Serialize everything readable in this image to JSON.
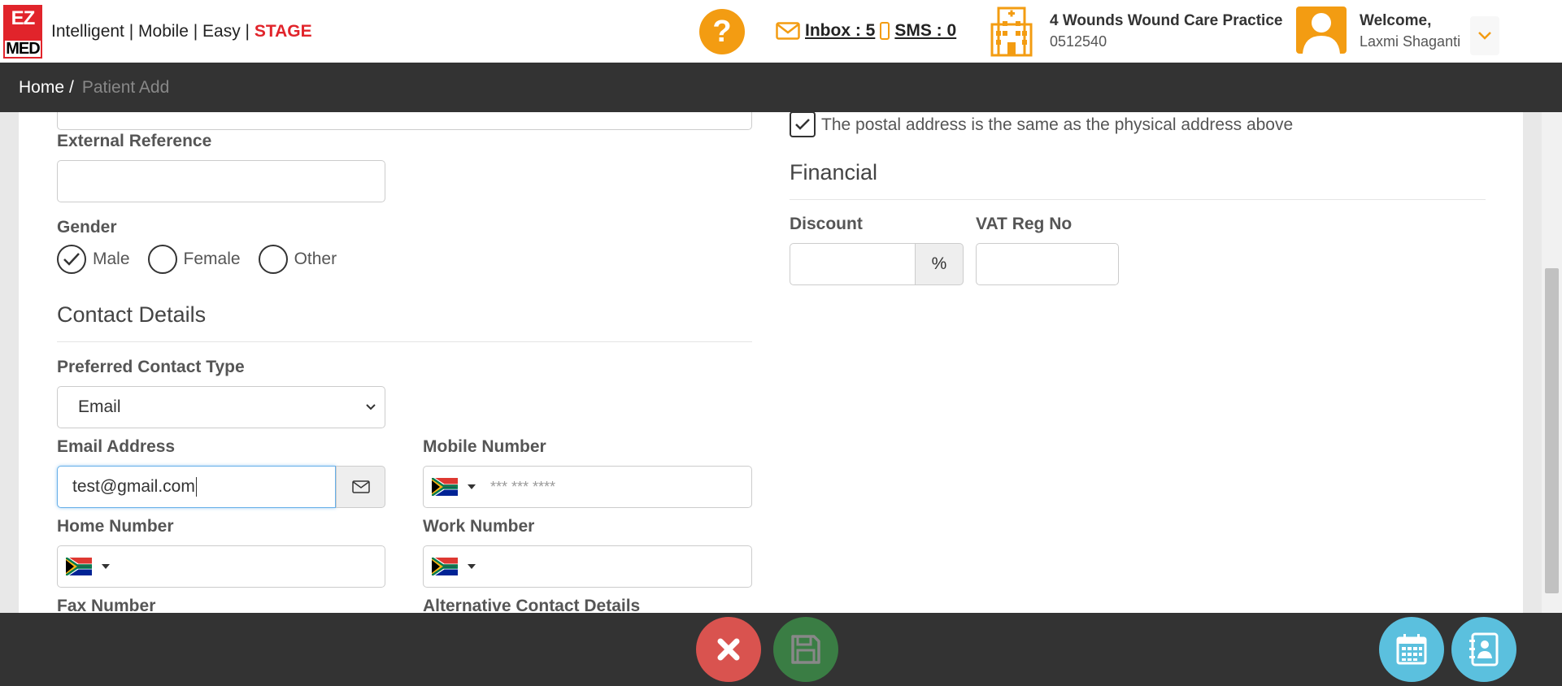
{
  "header": {
    "logo_top": "EZ",
    "logo_bottom": "MED",
    "tagline": "Intelligent | Mobile | Easy | ",
    "stage": "STAGE",
    "help_symbol": "?",
    "inbox_label": " Inbox : 5",
    "sms_label": " SMS : 0",
    "practice_name": "4 Wounds Wound Care Practice",
    "practice_code": "0512540",
    "welcome": "Welcome,",
    "user_name": "Laxmi Shaganti",
    "accent_color": "#f39c12",
    "brand_color": "#e1242b"
  },
  "breadcrumb": {
    "home": "Home",
    "separator": "/",
    "current": "Patient Add"
  },
  "form": {
    "external_reference_label": "External Reference",
    "external_reference_value": "",
    "gender_label": "Gender",
    "gender_options": [
      "Male",
      "Female",
      "Other"
    ],
    "gender_selected": "Male",
    "contact_section_title": "Contact Details",
    "preferred_contact_label": "Preferred Contact Type",
    "preferred_contact_value": "Email",
    "email_label": "Email Address",
    "email_value": "test@gmail.com",
    "mobile_label": "Mobile Number",
    "mobile_placeholder": "*** *** ****",
    "home_label": "Home Number",
    "work_label": "Work Number",
    "fax_label": "Fax Number",
    "alt_contact_label": "Alternative Contact Details",
    "postal_same_label": "The postal address is the same as the physical address above",
    "postal_same_checked": true,
    "financial_title": "Financial",
    "discount_label": "Discount",
    "discount_addon": "%",
    "vat_label": "VAT Reg No"
  },
  "icons": {
    "help": "question-icon",
    "inbox": "envelope-icon",
    "sms": "mobile-phone-icon",
    "practice": "hospital-building-icon",
    "avatar": "user-avatar-icon",
    "dropdown": "chevron-down-icon",
    "email_addon": "envelope-icon",
    "cancel": "close-icon",
    "save": "floppy-disk-icon",
    "calendar": "calendar-icon",
    "contacts": "address-book-icon"
  }
}
